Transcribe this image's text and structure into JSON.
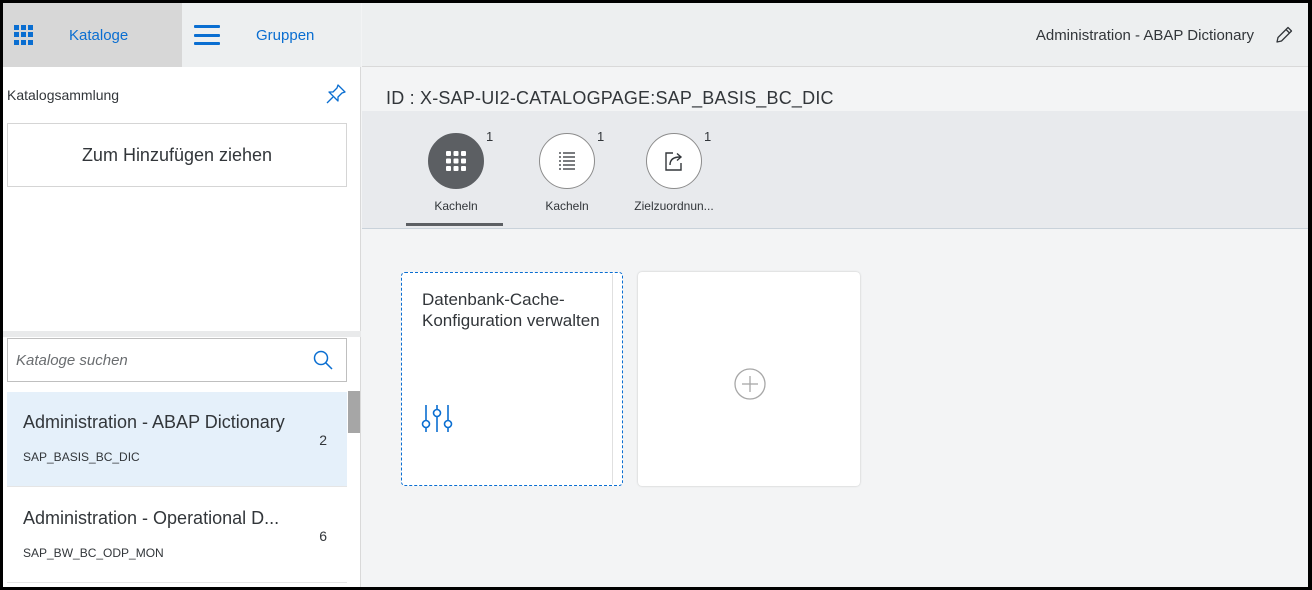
{
  "left": {
    "tabs": [
      {
        "label": "Kataloge",
        "icon": "grid-icon",
        "active": true
      },
      {
        "label": "Gruppen",
        "icon": "menu-icon",
        "active": false
      }
    ],
    "collection_title": "Katalogsammlung",
    "drop_zone_label": "Zum Hinzufügen ziehen",
    "search": {
      "placeholder": "Kataloge suchen"
    },
    "catalogs": [
      {
        "title": "Administration - ABAP Dictionary",
        "id": "SAP_BASIS_BC_DIC",
        "count": "2",
        "selected": true
      },
      {
        "title": "Administration - Operational D...",
        "id": "SAP_BW_BC_ODP_MON",
        "count": "6",
        "selected": false
      }
    ]
  },
  "header": {
    "title": "Administration - ABAP Dictionary"
  },
  "page": {
    "id_label": "ID : X-SAP-UI2-CATALOGPAGE:SAP_BASIS_BC_DIC"
  },
  "icon_tabs": [
    {
      "label": "Kacheln",
      "count": "1",
      "icon": "tiles-icon",
      "selected": true
    },
    {
      "label": "Kacheln",
      "count": "1",
      "icon": "list-icon",
      "selected": false
    },
    {
      "label": "Zielzuordnun...",
      "count": "1",
      "icon": "share-icon",
      "selected": false
    }
  ],
  "tiles": [
    {
      "title": "Datenbank-Cache-Konfiguration verwalten",
      "icon": "settings-sliders-icon"
    }
  ],
  "colors": {
    "accent": "#0a6ed1",
    "selected_row": "#e5f0fa",
    "active_tab": "#5c5f63"
  }
}
